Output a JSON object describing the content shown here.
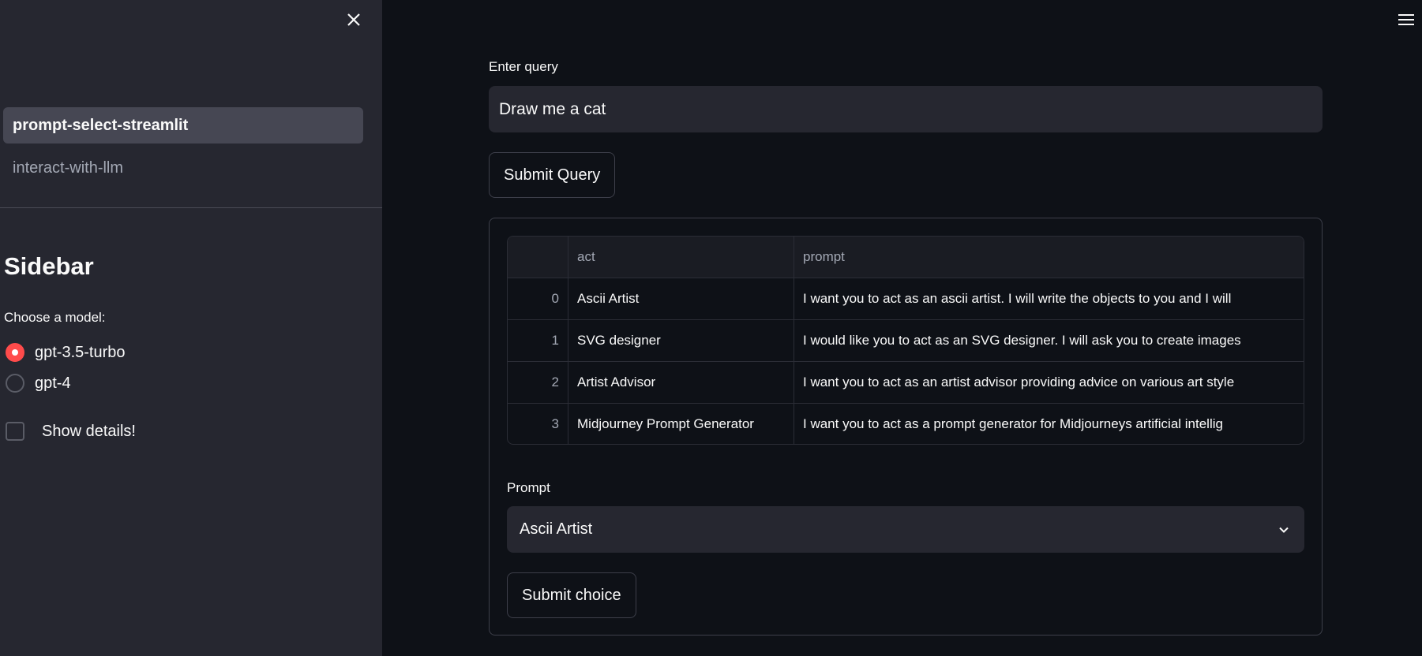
{
  "sidebar": {
    "nav": [
      {
        "label": "prompt-select-streamlit",
        "selected": true
      },
      {
        "label": "interact-with-llm",
        "selected": false
      }
    ],
    "title": "Sidebar",
    "model_label": "Choose a model:",
    "models": [
      {
        "label": "gpt-3.5-turbo",
        "selected": true
      },
      {
        "label": "gpt-4",
        "selected": false
      }
    ],
    "show_details": {
      "label": "Show details!",
      "checked": false
    }
  },
  "main": {
    "query_label": "Enter query",
    "query_value": "Draw me a cat",
    "submit_query": "Submit Query",
    "table": {
      "columns": [
        "",
        "act",
        "prompt"
      ],
      "rows": [
        [
          "0",
          "Ascii Artist",
          "I want you to act as an ascii artist. I will write the objects to you and I will"
        ],
        [
          "1",
          "SVG designer",
          "I would like you to act as an SVG designer. I will ask you to create images"
        ],
        [
          "2",
          "Artist Advisor",
          "I want you to act as an artist advisor providing advice on various art style"
        ],
        [
          "3",
          "Midjourney Prompt Generator",
          "I want you to act as a prompt generator for Midjourneys artificial intellig"
        ]
      ]
    },
    "prompt_label": "Prompt",
    "prompt_selected": "Ascii Artist",
    "submit_choice": "Submit choice"
  },
  "colors": {
    "accent": "#ff4b4b",
    "background": "#0e1117",
    "sidebar": "#262730"
  }
}
